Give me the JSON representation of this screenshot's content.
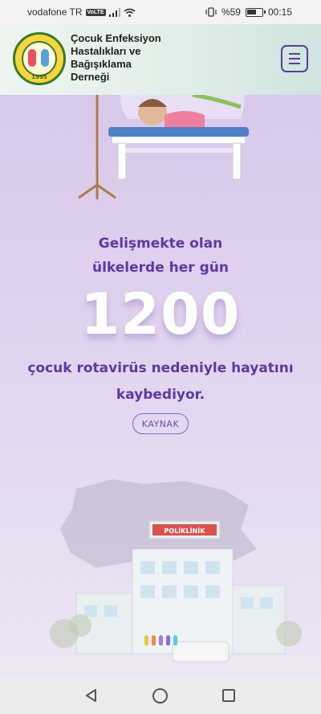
{
  "status_bar": {
    "carrier": "vodafone TR",
    "volte": "VoLTE",
    "battery": "%59",
    "time": "00:15"
  },
  "header": {
    "org_name_lines": [
      "Çocuk Enfeksiyon",
      "Hastalıkları ve",
      "Bağışıklama",
      "Derneği"
    ],
    "logo_year": "1995"
  },
  "hero": {
    "headline_lines": [
      "Gelişmekte olan",
      "ülkelerde her gün"
    ],
    "big_number": "1200",
    "subline_lines": [
      "çocuk rotavirüs nedeniyle hayatını",
      "kaybediyor."
    ],
    "source_label": "KAYNAK",
    "clinic_sign": "POLİKLİNİK",
    "pagination_colors": [
      "#f0c338",
      "#ef8a4b",
      "#9b7de0",
      "#7e72e8",
      "#5fc6e8"
    ]
  },
  "colors": {
    "accent": "#5d3a9d",
    "hero_bg": "#d8c8eb"
  }
}
